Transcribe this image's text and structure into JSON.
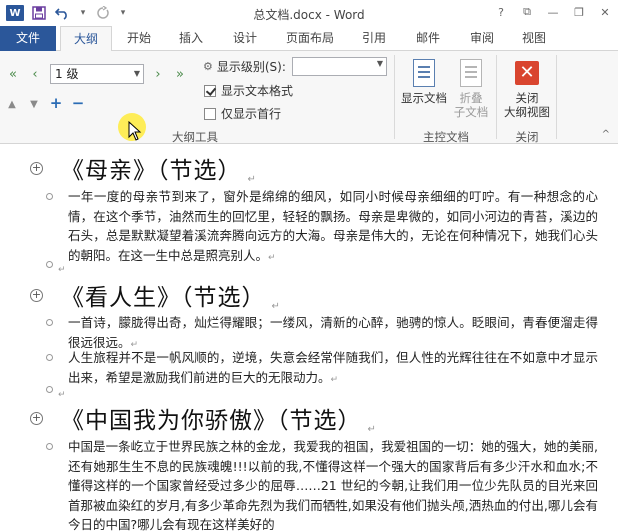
{
  "app": {
    "title": "总文档.docx - Word",
    "logo": "W",
    "window_controls": [
      "?",
      "⧉",
      "—",
      "❐",
      "✕"
    ]
  },
  "tabs": [
    "文件",
    "大纲",
    "开始",
    "插入",
    "设计",
    "页面布局",
    "引用",
    "邮件",
    "审阅",
    "视图"
  ],
  "active_tab": "大纲",
  "ribbon": {
    "level_value": "1 级",
    "show_level_label": "显示级别(S):",
    "show_level_value": "",
    "show_text_format_label": "显示文本格式",
    "show_text_format_checked": true,
    "first_line_only_label": "仅显示首行",
    "first_line_only_checked": false,
    "group_outline_tools": "大纲工具",
    "show_document_label": "显示文档",
    "collapse_sub_label_1": "折叠",
    "collapse_sub_label_2": "子文档",
    "group_master_document": "主控文档",
    "close_outline_label_1": "关闭",
    "close_outline_label_2": "大纲视图",
    "group_close": "关闭"
  },
  "document": {
    "headings": [
      "《母亲》（节选）",
      "《看人生》（节选）",
      "《中国我为你骄傲》（节选）"
    ],
    "paragraphs": [
      "一年一度的母亲节到来了，窗外是绵绵的细风，如同小时候母亲细细的叮咛。有一种想念的心情，在这个季节，油然而生的回忆里，轻轻的飘扬。母亲是卑微的，如同小河边的青苔，溪边的石头，总是默默凝望着溪流奔腾向远方的大海。母亲是伟大的，无论在何种情况下，她我们心头的朝阳。在这一生中总是照亮别人。",
      "一首诗，朦胧得出奇，灿烂得耀眼；一缕风，清新的心醉，驰骋的惊人。眨眼间，青春便溜走得很远很远。",
      "人生旅程并不是一帆风顺的，逆境，失意会经常伴随我们，但人性的光辉往往在不如意中才显示出来，希望是激励我们前进的巨大的无限动力。",
      "中国是一条屹立于世界民族之林的金龙，我爱我的祖国，我爱祖国的一切：她的强大，她的美丽,还有她那生生不息的民族魂魄!!!以前的我,不懂得这样一个强大的国家背后有多少汗水和血水;不懂得这样的一个国家曾经受过多少的屈辱……21 世纪的今朝,让我们用一位少先队员的目光来回首那被血染红的岁月,有多少革命先烈为我们而牺牲,如果没有他们抛头颅,洒热血的付出,哪儿会有今日的中国?哪儿会有现在这样美好的"
    ],
    "para_mark": "↵"
  },
  "colors": {
    "accent": "#2b579a",
    "close_red": "#d9452f",
    "cursor_highlight": "#ffeb3c"
  }
}
